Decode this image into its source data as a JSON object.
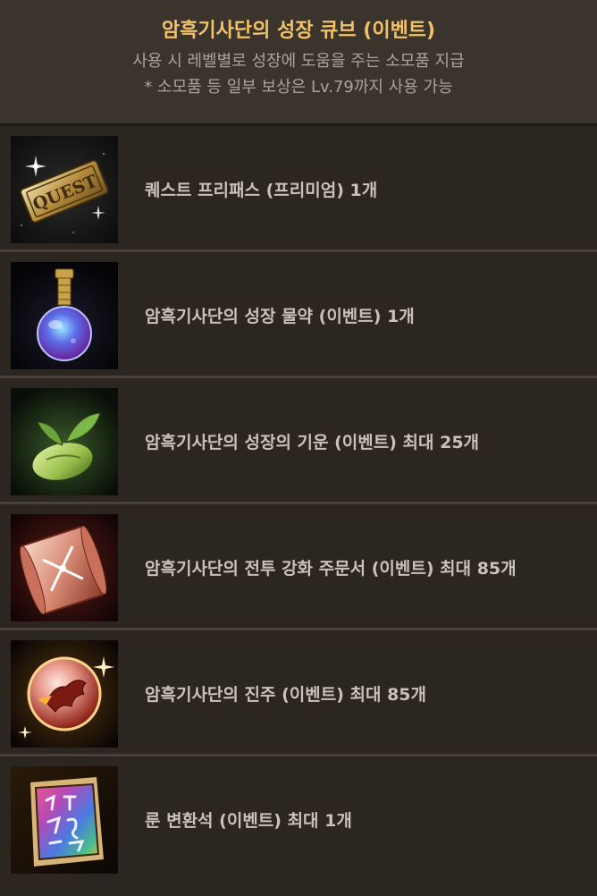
{
  "header": {
    "title": "암흑기사단의 성장 큐브 (이벤트)",
    "line1": "사용 시 레벨별로 성장에 도움을 주는 소모품 지급",
    "line2": "* 소모품 등 일부 보상은 Lv.79까지 사용 가능"
  },
  "items": [
    {
      "label": "퀘스트 프리패스 (프리미엄) 1개",
      "icon": "quest-ticket-icon",
      "icon_text": "QUEST"
    },
    {
      "label": "암흑기사단의 성장 물약 (이벤트) 1개",
      "icon": "potion-icon"
    },
    {
      "label": "암흑기사단의 성장의 기운 (이벤트) 최대 25개",
      "icon": "sprout-icon"
    },
    {
      "label": "암흑기사단의 전투 강화 주문서 (이벤트) 최대 85개",
      "icon": "scroll-icon"
    },
    {
      "label": "암흑기사단의 진주 (이벤트) 최대 85개",
      "icon": "dragon-pearl-icon"
    },
    {
      "label": "룬 변환석 (이벤트) 최대 1개",
      "icon": "rune-stone-icon"
    }
  ],
  "colors": {
    "title": "#f2c26a",
    "text": "#c9c2b8",
    "subtext": "#a9a39a",
    "header_bg": "#3a342d",
    "row_bg": "#2b2620",
    "divider": "#4a423a"
  }
}
